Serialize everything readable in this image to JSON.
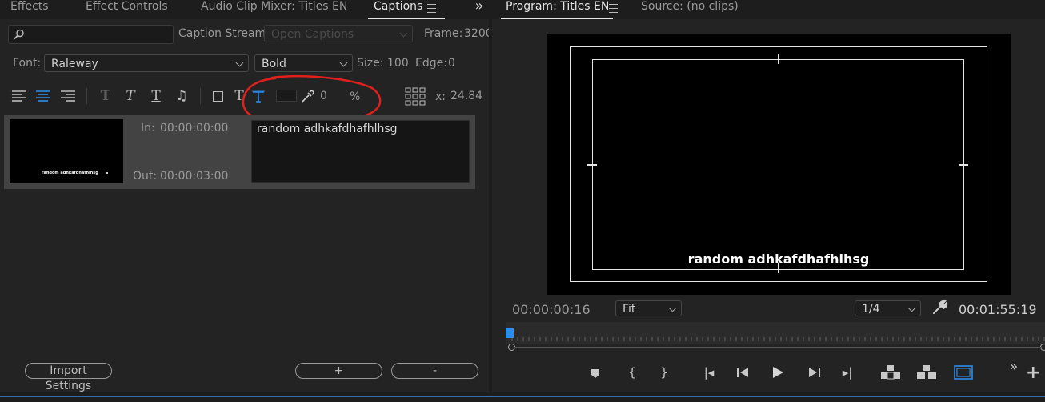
{
  "left_panel": {
    "tabs": [
      {
        "label": "Effects"
      },
      {
        "label": "Effect Controls"
      },
      {
        "label": "Audio Clip Mixer: Titles EN"
      },
      {
        "label": "Captions",
        "active": true
      }
    ],
    "caption_stream_label": "Caption Stream:",
    "caption_stream_value": "Open Captions",
    "frame_label": "Frame:",
    "frame_value": "3200",
    "font_label": "Font:",
    "font_value": "Raleway",
    "style_value": "Bold",
    "size_label": "Size:",
    "size_value": "100",
    "edge_label": "Edge:",
    "edge_value": "0",
    "opacity_value": "0",
    "opacity_unit": "%",
    "x_label": "x:",
    "x_value": "24.84",
    "caption": {
      "in_label": "In:",
      "in_time": "00:00:00:00",
      "out_label": "Out:",
      "out_time": "00:00:03:00",
      "text": "random adhkafdhafhlhsg",
      "thumb_text": "random adhkafdhafhlhsg"
    },
    "import_settings_label": "Import Settings",
    "add_label": "+",
    "remove_label": "-"
  },
  "right_panel": {
    "program_tab": "Program: Titles EN",
    "source_tab": "Source: (no clips)",
    "overlay_text": "random adhkafdhafhlhsg",
    "current_time": "00:00:00:16",
    "fit_value": "Fit",
    "resolution_value": "1/4",
    "duration": "00:01:55:19"
  },
  "colors": {
    "accent_blue": "#2d8ceb",
    "annotation_red": "#e0201c",
    "panel_bg": "#232323"
  }
}
